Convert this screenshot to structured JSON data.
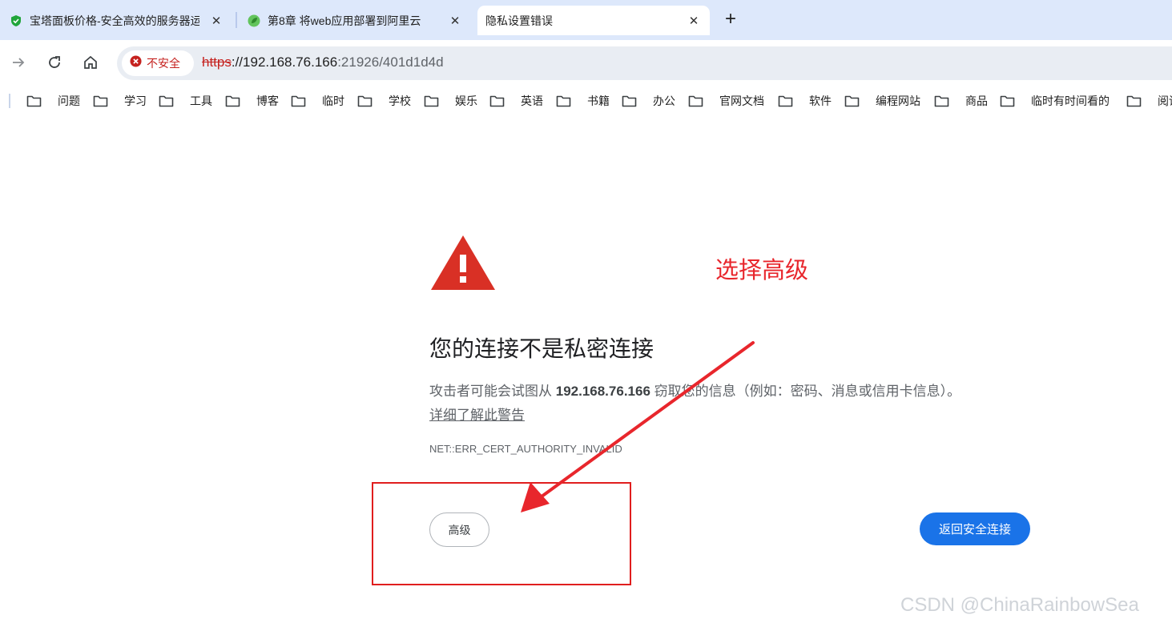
{
  "tabs": [
    {
      "title": "宝塔面板价格-安全高效的服务器运维面板",
      "close_label": "✕"
    },
    {
      "title": "第8章 将web应用部署到阿里云",
      "close_label": "✕"
    },
    {
      "title": "隐私设置错误",
      "close_label": "✕"
    }
  ],
  "new_tab_label": "+",
  "toolbar": {
    "security_label": "不安全",
    "url_scheme": "https",
    "url_host": "://192.168.76.166",
    "url_rest": ":21926/401d1d4d"
  },
  "bookmarks": [
    "问题",
    "学习",
    "工具",
    "博客",
    "临时",
    "学校",
    "娱乐",
    "英语",
    "书籍",
    "办公",
    "官网文档",
    "软件",
    "编程网站",
    "商品",
    "临时有时间看的",
    "阅读"
  ],
  "interstitial": {
    "heading": "您的连接不是私密连接",
    "desc_prefix": "攻击者可能会试图从 ",
    "desc_host": "192.168.76.166",
    "desc_suffix": " 窃取您的信息（例如：密码、消息或信用卡信息）。",
    "learn_more": "详细了解此警告",
    "error_code": "NET::ERR_CERT_AUTHORITY_INVALID",
    "advanced_label": "高级",
    "back_label": "返回安全连接"
  },
  "annotation": {
    "text": "选择高级",
    "color": "#e8262c"
  },
  "watermark": "CSDN @ChinaRainbowSea",
  "colors": {
    "tabstrip_bg": "#dde8fb",
    "primary_button": "#1a73e8",
    "warning_red": "#d93025"
  }
}
